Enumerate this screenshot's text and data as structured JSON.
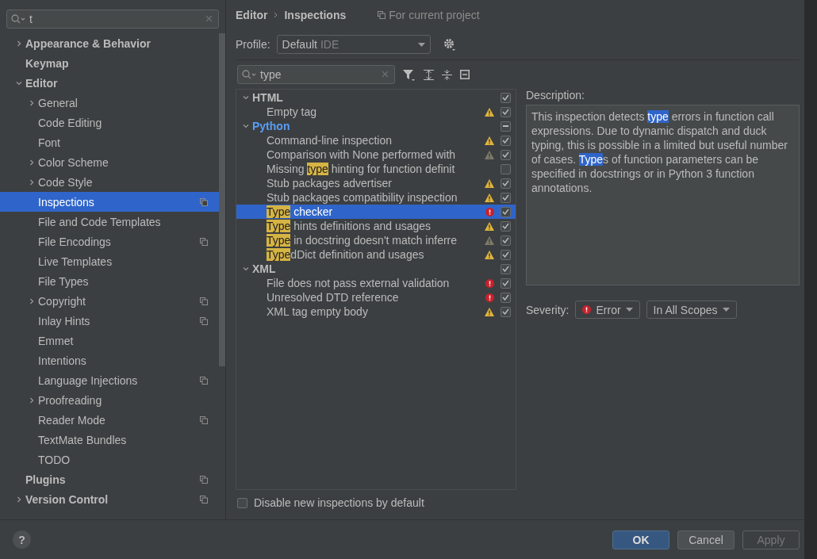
{
  "sidebar": {
    "search": {
      "value": "t"
    },
    "items": [
      {
        "label": "Appearance & Behavior",
        "expanded": false
      },
      {
        "label": "Keymap"
      },
      {
        "label": "Editor",
        "expanded": true,
        "children": [
          {
            "label": "General",
            "expanded": false
          },
          {
            "label": "Code Editing"
          },
          {
            "label": "Font"
          },
          {
            "label": "Color Scheme",
            "expanded": false
          },
          {
            "label": "Code Style",
            "expanded": false
          },
          {
            "label": "Inspections",
            "selected": true,
            "project_level": true
          },
          {
            "label": "File and Code Templates"
          },
          {
            "label": "File Encodings",
            "project_level": true
          },
          {
            "label": "Live Templates"
          },
          {
            "label": "File Types"
          },
          {
            "label": "Copyright",
            "expanded": false,
            "project_level": true
          },
          {
            "label": "Inlay Hints",
            "project_level": true
          },
          {
            "label": "Emmet"
          },
          {
            "label": "Intentions"
          },
          {
            "label": "Language Injections",
            "project_level": true
          },
          {
            "label": "Proofreading",
            "expanded": false
          },
          {
            "label": "Reader Mode",
            "project_level": true
          },
          {
            "label": "TextMate Bundles"
          },
          {
            "label": "TODO"
          }
        ]
      },
      {
        "label": "Plugins",
        "project_level": true
      },
      {
        "label": "Version Control",
        "expanded": false,
        "project_level": true
      }
    ]
  },
  "breadcrumb": [
    "Editor",
    "Inspections"
  ],
  "scope_note": "For current project",
  "profile": {
    "label": "Profile:",
    "value": "Default",
    "qualifier": "IDE"
  },
  "filter": {
    "value": "type"
  },
  "inspections": [
    {
      "label": [
        {
          "text": "HTML"
        }
      ],
      "checked": true,
      "expanded": true,
      "children": [
        {
          "label": [
            {
              "text": "Empty tag"
            }
          ],
          "kind": "warning",
          "checked": true
        }
      ]
    },
    {
      "label": [
        {
          "text": "Python"
        }
      ],
      "checked": true,
      "partial": true,
      "expanded": true,
      "modified": true,
      "children": [
        {
          "label": [
            {
              "text": "Command-line inspection"
            }
          ],
          "kind": "warning",
          "checked": true
        },
        {
          "label": [
            {
              "text": "Comparison with None performed with"
            }
          ],
          "kind": "weak",
          "checked": true
        },
        {
          "label": [
            {
              "text": "Missing "
            },
            {
              "text": "type",
              "match": true
            },
            {
              "text": " hinting for function definit"
            }
          ],
          "kind": "plain",
          "checked": false
        },
        {
          "label": [
            {
              "text": "Stub packages advertiser"
            }
          ],
          "kind": "warning",
          "checked": true
        },
        {
          "label": [
            {
              "text": "Stub packages compatibility inspection"
            }
          ],
          "kind": "warning",
          "checked": true
        },
        {
          "label": [
            {
              "text": "Type",
              "match": true
            },
            {
              "text": " checker"
            }
          ],
          "kind": "error",
          "checked": true,
          "selected": true
        },
        {
          "label": [
            {
              "text": "Type",
              "match": true
            },
            {
              "text": " hints definitions and usages"
            }
          ],
          "kind": "warning",
          "checked": true
        },
        {
          "label": [
            {
              "text": "Type",
              "match": true
            },
            {
              "text": " in docstring doesn't match inferre"
            }
          ],
          "kind": "weak",
          "checked": true
        },
        {
          "label": [
            {
              "text": "Type",
              "match": true
            },
            {
              "text": "dDict definition and usages"
            }
          ],
          "kind": "warning",
          "checked": true
        }
      ]
    },
    {
      "label": [
        {
          "text": "XML"
        }
      ],
      "checked": true,
      "expanded": true,
      "children": [
        {
          "label": [
            {
              "text": "File does not pass external validation"
            }
          ],
          "kind": "error",
          "checked": true
        },
        {
          "label": [
            {
              "text": "Unresolved DTD reference"
            }
          ],
          "kind": "error",
          "checked": true
        },
        {
          "label": [
            {
              "text": "XML tag empty body"
            }
          ],
          "kind": "warning",
          "checked": true
        }
      ]
    }
  ],
  "disable_new": {
    "label": "Disable new inspections by default",
    "checked": false
  },
  "description": {
    "title": "Description:",
    "text": [
      {
        "text": "This inspection detects "
      },
      {
        "text": "type",
        "match": true
      },
      {
        "text": " errors in function call expressions. Due to dynamic dispatch and duck typing, this is possible in a limited but useful number of cases. "
      },
      {
        "text": "Type",
        "match": true
      },
      {
        "text": "s of function parameters can be specified in docstrings or in Python 3 function annotations."
      }
    ]
  },
  "severity": {
    "label": "Severity:",
    "value": "Error",
    "kind": "error",
    "scope": "In All Scopes"
  },
  "help": "?",
  "buttons": [
    {
      "label": "OK",
      "kind": "primary"
    },
    {
      "label": "Cancel",
      "kind": "normal"
    },
    {
      "label": "Apply",
      "kind": "disabled"
    }
  ]
}
